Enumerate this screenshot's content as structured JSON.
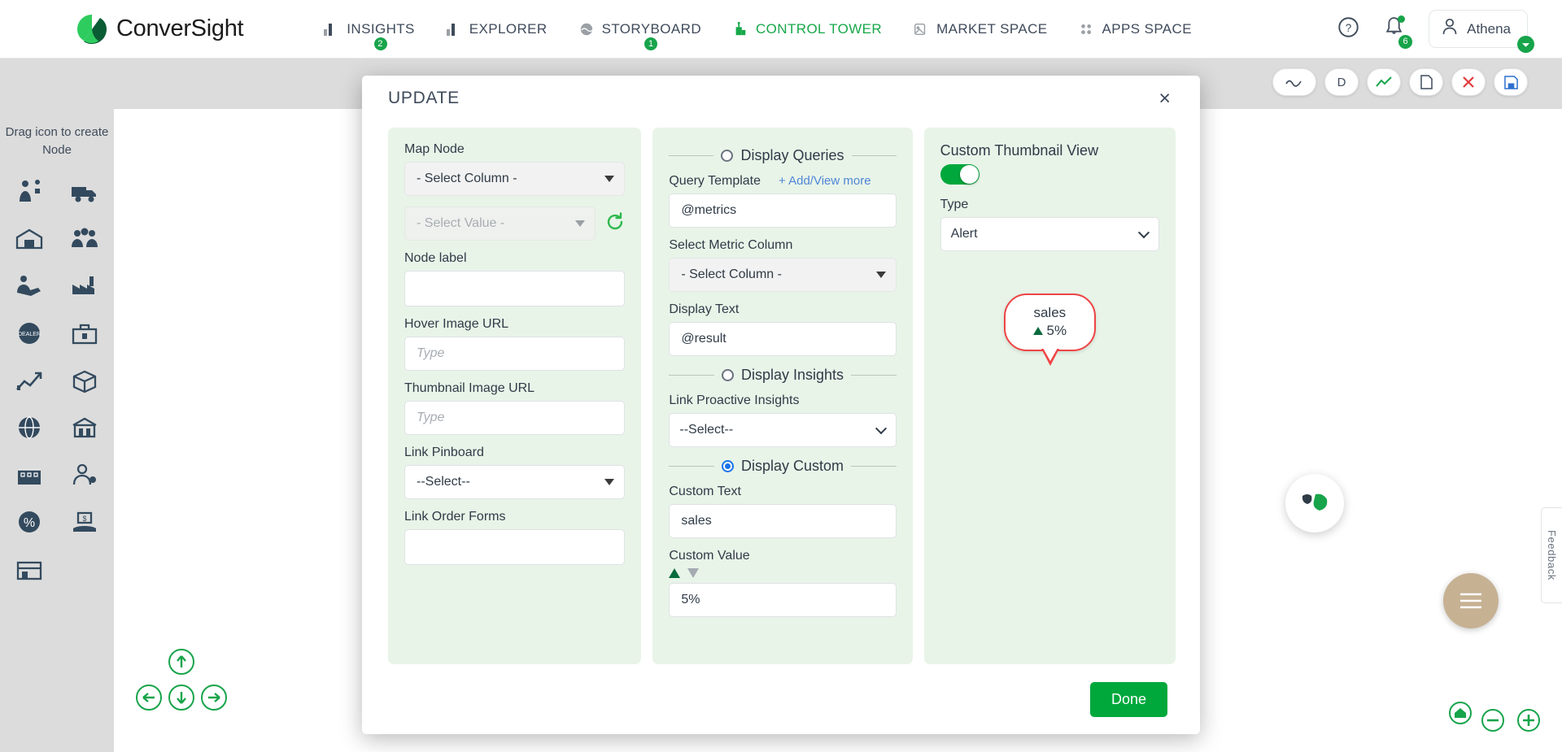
{
  "topnav": {
    "brand": "ConverSight",
    "items": [
      {
        "label": "INSIGHTS",
        "icon": "bar-chart-icon",
        "badge": "2",
        "active": false
      },
      {
        "label": "EXPLORER",
        "icon": "bar-chart-icon",
        "badge": "",
        "active": false
      },
      {
        "label": "STORYBOARD",
        "icon": "globe-icon",
        "badge": "1",
        "active": false
      },
      {
        "label": "CONTROL TOWER",
        "icon": "control-tower-icon",
        "badge": "",
        "active": true
      },
      {
        "label": "MARKET SPACE",
        "icon": "market-space-icon",
        "badge": "",
        "active": false
      },
      {
        "label": "APPS SPACE",
        "icon": "grid-dots-icon",
        "badge": "",
        "active": false
      }
    ],
    "help_icon": "help-circle-icon",
    "notification_icon": "bell-icon",
    "notification_count": "6",
    "user_name": "Athena",
    "user_icon": "user-icon"
  },
  "canvas": {
    "rail_hint": "Drag icon to create Node",
    "feedback_label": "Feedback",
    "toolbar": [
      {
        "icon": "wave-icon",
        "label": ""
      },
      {
        "icon": "letter-d-icon",
        "label": "D"
      },
      {
        "icon": "trend-up-icon",
        "label": ""
      },
      {
        "icon": "file-icon",
        "label": ""
      },
      {
        "icon": "close-red-icon",
        "label": ""
      },
      {
        "icon": "save-icon",
        "label": ""
      }
    ],
    "rail_icons": [
      "person-network-icon",
      "delivery-truck-icon",
      "warehouse-icon",
      "people-group-icon",
      "handshake-icon",
      "factory-icon",
      "dealer-badge-icon",
      "toolbox-icon",
      "growth-chart-icon",
      "package-box-icon",
      "globe-network-icon",
      "bank-building-icon",
      "store-icon",
      "person-support-icon",
      "percent-tag-icon",
      "money-hand-icon",
      "shop-front-icon",
      ""
    ]
  },
  "modal": {
    "title": "UPDATE",
    "close_label": "×",
    "done_label": "Done",
    "left": {
      "map_node_label": "Map Node",
      "map_node_column": "- Select Column -",
      "map_node_value": "- Select Value -",
      "refresh_icon": "refresh-icon",
      "node_label_label": "Node label",
      "node_label_value": "",
      "hover_image_label": "Hover Image URL",
      "hover_image_placeholder": "Type",
      "hover_image_value": "",
      "thumbnail_image_label": "Thumbnail Image URL",
      "thumbnail_image_placeholder": "Type",
      "thumbnail_image_value": "",
      "link_pinboard_label": "Link Pinboard",
      "link_pinboard_value": "--Select--",
      "link_order_forms_label": "Link Order Forms",
      "link_order_forms_value": ""
    },
    "mid": {
      "display_queries_label": "Display Queries",
      "display_queries_selected": false,
      "query_template_label": "Query Template",
      "add_view_more_label": "+ Add/View more",
      "query_template_value": "@metrics",
      "select_metric_label": "Select Metric Column",
      "select_metric_value": "- Select Column -",
      "display_text_label": "Display Text",
      "display_text_value": "@result",
      "display_insights_label": "Display Insights",
      "display_insights_selected": false,
      "link_proactive_label": "Link Proactive Insights",
      "link_proactive_value": "--Select--",
      "display_custom_label": "Display Custom",
      "display_custom_selected": true,
      "custom_text_label": "Custom Text",
      "custom_text_value": "sales",
      "custom_value_label": "Custom Value",
      "custom_value_value": "5%",
      "trend_up_icon": "triangle-up-icon",
      "trend_down_icon": "triangle-down-icon"
    },
    "right": {
      "title": "Custom Thumbnail View",
      "toggle_on": true,
      "type_label": "Type",
      "type_value": "Alert",
      "preview_text": "sales",
      "preview_value": "5%",
      "preview_trend_icon": "triangle-up-icon"
    }
  },
  "colors": {
    "brand_green": "#00a83c",
    "accent_blue": "#4f86d6",
    "panel_green": "#e8f4e8",
    "alert_red": "#ef4444",
    "nav_text": "#3f4b5b"
  }
}
